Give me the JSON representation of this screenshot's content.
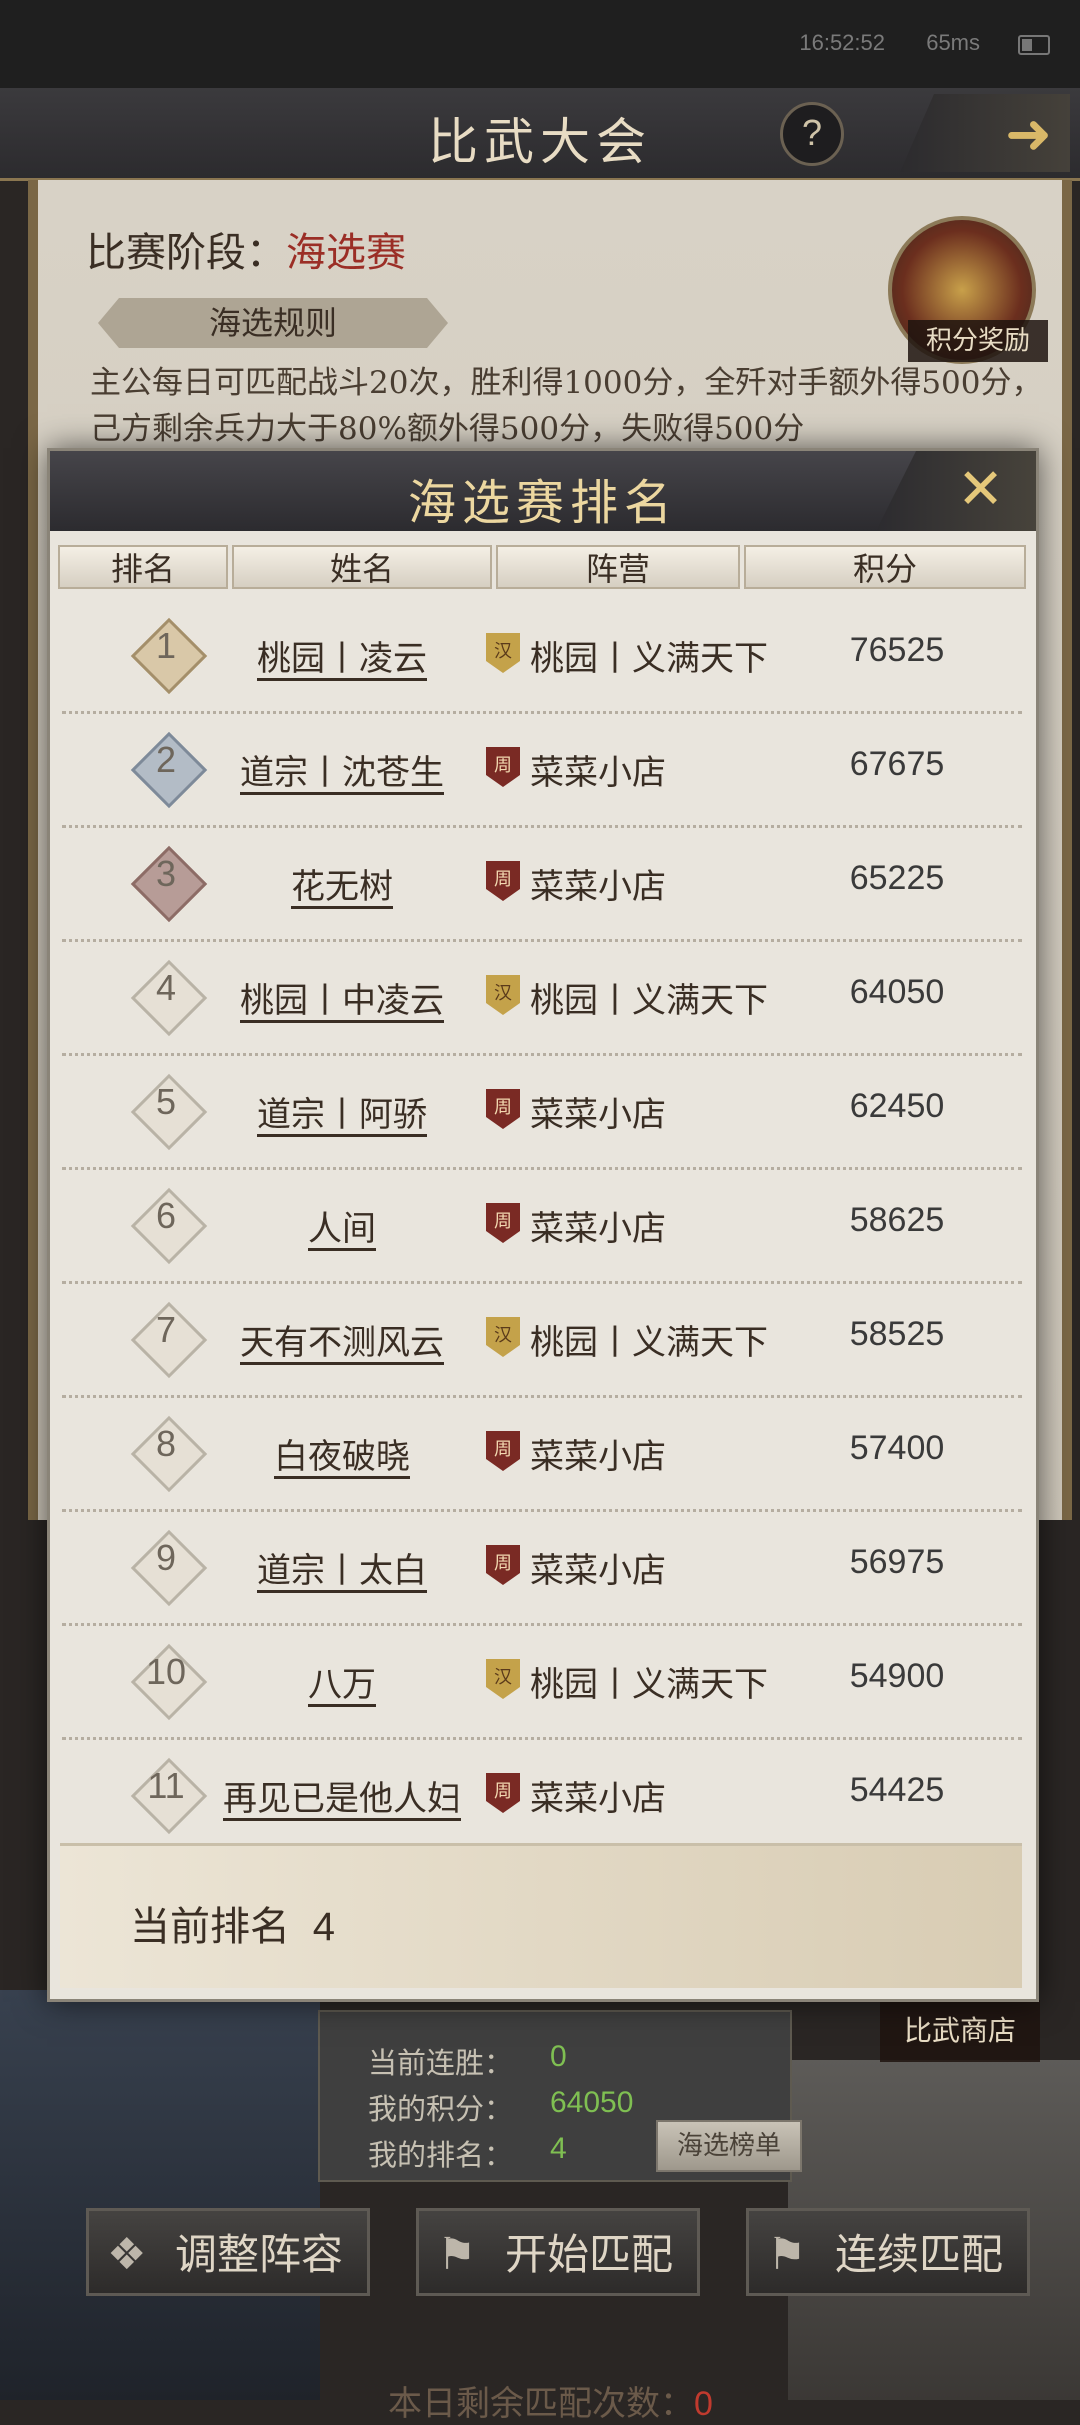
{
  "status": {
    "time": "16:52:52",
    "network": "65ms"
  },
  "header": {
    "title": "比武大会",
    "help_label": "?",
    "back_label": "➜"
  },
  "stage": {
    "label": "比赛阶段：",
    "value": "海选赛"
  },
  "rules": {
    "button_label": "海选规则",
    "text": "主公每日可匹配战斗20次，胜利得1000分，全歼对手额外得500分，己方剩余兵力大于80%额外得500分，失败得500分"
  },
  "reward": {
    "label": "积分奖励"
  },
  "ranking": {
    "title": "海选赛排名",
    "close_label": "✕",
    "columns": [
      "排名",
      "姓名",
      "阵营",
      "积分"
    ],
    "rows": [
      {
        "rank": "1",
        "name": "桃园丨凌云",
        "camp_icon": "汉",
        "camp": "桃园丨义满天下",
        "score": "76525"
      },
      {
        "rank": "2",
        "name": "道宗丨沈苍生",
        "camp_icon": "周",
        "camp": "菜菜小店",
        "score": "67675"
      },
      {
        "rank": "3",
        "name": "花无树",
        "camp_icon": "周",
        "camp": "菜菜小店",
        "score": "65225"
      },
      {
        "rank": "4",
        "name": "桃园丨中凌云",
        "camp_icon": "汉",
        "camp": "桃园丨义满天下",
        "score": "64050"
      },
      {
        "rank": "5",
        "name": "道宗丨阿骄",
        "camp_icon": "周",
        "camp": "菜菜小店",
        "score": "62450"
      },
      {
        "rank": "6",
        "name": "人间",
        "camp_icon": "周",
        "camp": "菜菜小店",
        "score": "58625"
      },
      {
        "rank": "7",
        "name": "天有不测风云",
        "camp_icon": "汉",
        "camp": "桃园丨义满天下",
        "score": "58525"
      },
      {
        "rank": "8",
        "name": "白夜破晓",
        "camp_icon": "周",
        "camp": "菜菜小店",
        "score": "57400"
      },
      {
        "rank": "9",
        "name": "道宗丨太白",
        "camp_icon": "周",
        "camp": "菜菜小店",
        "score": "56975"
      },
      {
        "rank": "10",
        "name": "八万",
        "camp_icon": "汉",
        "camp": "桃园丨义满天下",
        "score": "54900"
      },
      {
        "rank": "11",
        "name": "再见已是他人妇",
        "camp_icon": "周",
        "camp": "菜菜小店",
        "score": "54425"
      }
    ],
    "current_rank_label": "当前排名",
    "current_rank_value": "4"
  },
  "shop": {
    "label": "比武商店"
  },
  "my_stats": {
    "streak_label": "当前连胜：",
    "streak_value": "0",
    "score_label": "我的积分：",
    "score_value": "64050",
    "rank_label": "我的排名：",
    "rank_value": "4",
    "leaderboard_button": "海选榜单"
  },
  "actions": {
    "adjust_label": "调整阵容",
    "start_label": "开始匹配",
    "continuous_label": "连续匹配",
    "remaining_label": "本日剩余匹配次数：",
    "remaining_value": "0"
  },
  "colors": {
    "accent_gold": "#ecd7a0",
    "stage_red": "#9b2e26",
    "stat_green": "#7fbf52",
    "remaining_red": "#c03a2e"
  }
}
